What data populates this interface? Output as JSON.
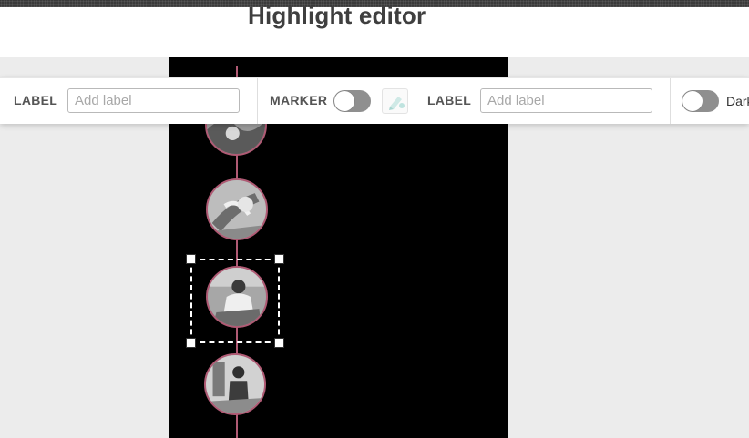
{
  "header": {
    "title": "Highlight editor"
  },
  "toolbar": {
    "label1": "LABEL",
    "input1_placeholder": "Add label",
    "marker_label": "MARKER",
    "label2": "LABEL",
    "input2_placeholder": "Add label",
    "dark_label": "Dark"
  },
  "colors": {
    "timeline": "#b05a74",
    "canvas_bg": "#000000",
    "toggle_off": "#8f8f8f"
  },
  "icons": [
    "marker-color-icon"
  ]
}
